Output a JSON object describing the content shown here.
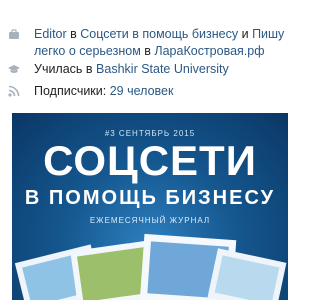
{
  "profile": {
    "work": {
      "icon": "briefcase-icon",
      "role": "Editor",
      "in1": "в",
      "company": "Соцсети в помощь бизнесу",
      "and": "и",
      "company2_part1": "Пишу",
      "company2_part2": "легко о серьезном",
      "in2": "в",
      "site": "ЛараКостровая.рф"
    },
    "education": {
      "icon": "graduation-cap-icon",
      "prefix": "Училась в",
      "school": "Bashkir State University"
    },
    "subscribers": {
      "icon": "rss-icon",
      "label": "Подписчики:",
      "count": "29 человек"
    }
  },
  "cover": {
    "issue": "#3 СЕНТЯБРЬ 2015",
    "title": "СОЦСЕТИ",
    "subtitle": "В ПОМОЩЬ БИЗНЕСУ",
    "tagline": "ЕЖЕМЕСЯЧНЫЙ ЖУРНАЛ"
  },
  "colors": {
    "link": "#2a5885",
    "icon": "#a8b2bd",
    "cover_bg": "#15578f"
  }
}
